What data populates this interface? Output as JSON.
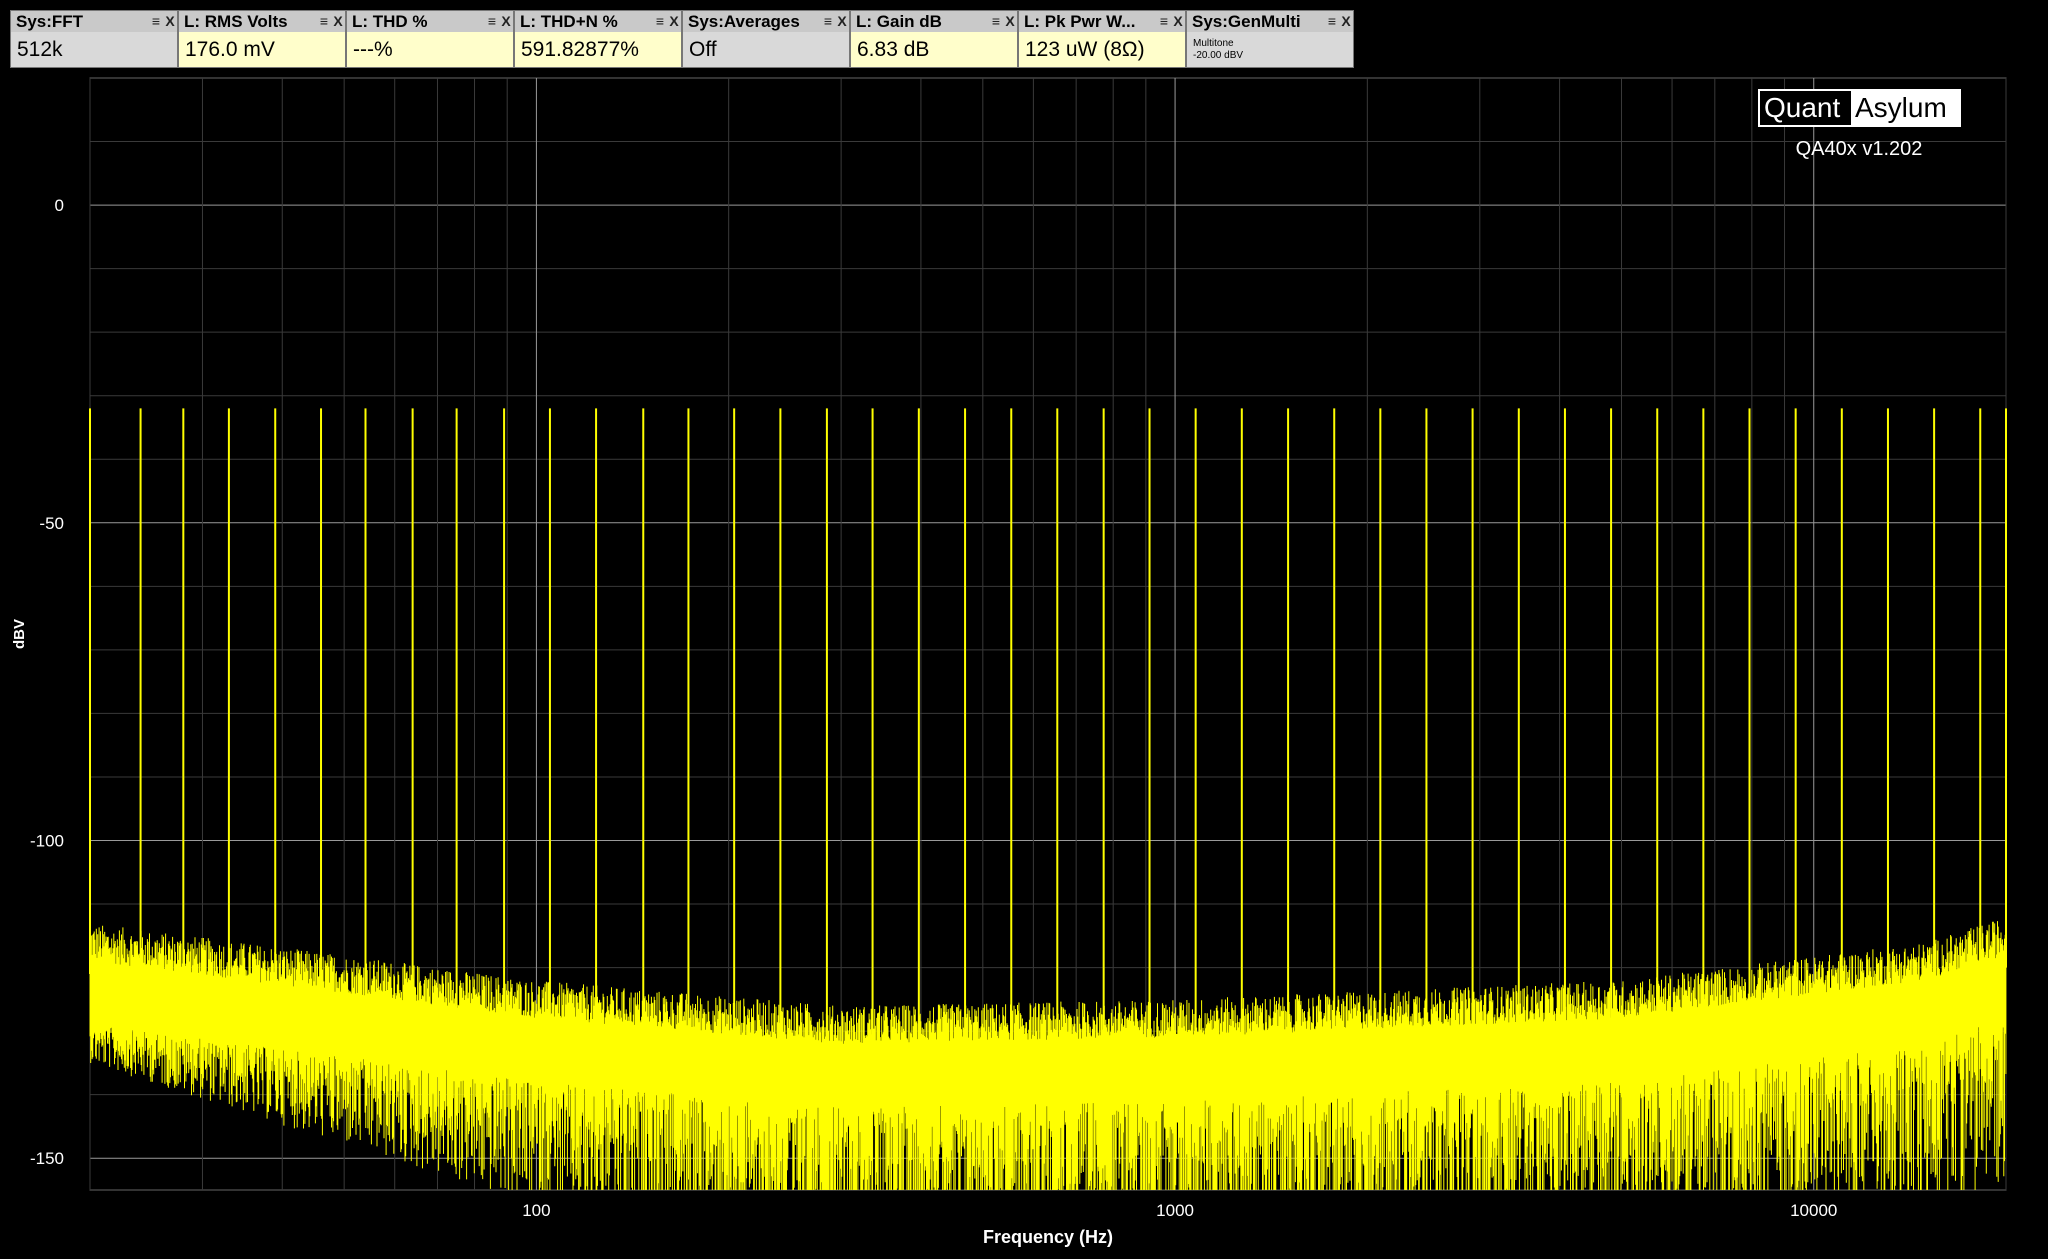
{
  "widgets": [
    {
      "title": "Sys:FFT",
      "value": "512k",
      "style": "gray"
    },
    {
      "title": "L: RMS Volts",
      "value": "176.0 mV",
      "style": "yellow"
    },
    {
      "title": "L: THD %",
      "value": "---%",
      "style": "yellow"
    },
    {
      "title": "L: THD+N %",
      "value": "591.82877%",
      "style": "yellow"
    },
    {
      "title": "Sys:Averages",
      "value": "Off",
      "style": "gray"
    },
    {
      "title": "L: Gain dB",
      "value": "6.83 dB",
      "style": "yellow"
    },
    {
      "title": "L: Pk Pwr W...",
      "value": "123 uW (8Ω)",
      "style": "yellow"
    },
    {
      "title": "Sys:GenMulti",
      "value": "Multitone",
      "value2": "-20.00 dBV",
      "style": "small"
    }
  ],
  "widget_icons": {
    "menu": "menu-icon",
    "close": "close-icon"
  },
  "brand": {
    "left": "Quant",
    "right": "Asylum",
    "version": "QA40x v1.202"
  },
  "chart_data": {
    "type": "line",
    "title": "",
    "xlabel": "Frequency (Hz)",
    "ylabel": "dBV",
    "x_scale": "log",
    "xlim": [
      20,
      20000
    ],
    "ylim": [
      -155,
      20
    ],
    "x_ticks": [
      100,
      1000,
      10000
    ],
    "x_tick_labels": [
      "100",
      "1000",
      "10000"
    ],
    "y_ticks": [
      0,
      -50,
      -100,
      -150
    ],
    "y_tick_labels": [
      "0",
      "-50",
      "-100",
      "-150"
    ],
    "grid": true,
    "line_color": "#ffff00",
    "series": [
      {
        "tones_hz": [
          20,
          24,
          28,
          33,
          39,
          46,
          54,
          64,
          75,
          89,
          105,
          124,
          147,
          173,
          204,
          241,
          285,
          336,
          397,
          469,
          554,
          654,
          773,
          912,
          1077,
          1272,
          1503,
          1775,
          2096,
          2475,
          2923,
          3453,
          4078,
          4816,
          5688,
          6717,
          7933,
          9369,
          11065,
          13068,
          15434,
          18227,
          20000
        ],
        "tone_level_dbv": -32,
        "noise_floor": [
          {
            "x": 20,
            "y": -125
          },
          {
            "x": 50,
            "y": -130
          },
          {
            "x": 100,
            "y": -134
          },
          {
            "x": 300,
            "y": -138
          },
          {
            "x": 1000,
            "y": -137
          },
          {
            "x": 5000,
            "y": -134
          },
          {
            "x": 15000,
            "y": -128
          },
          {
            "x": 20000,
            "y": -124
          }
        ]
      }
    ]
  }
}
